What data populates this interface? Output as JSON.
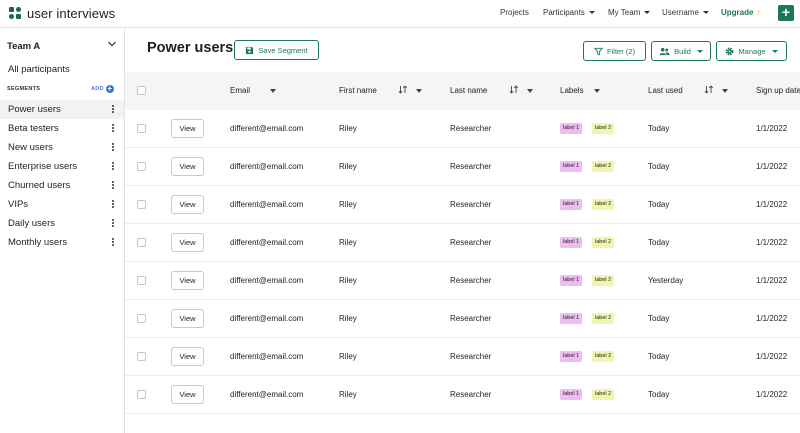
{
  "app": {
    "name": "user interviews",
    "brand_color": "#1c7a53"
  },
  "topnav": {
    "projects": "Projects",
    "participants": "Participants",
    "my_team": "My Team",
    "username": "Username",
    "upgrade": "Upgrade",
    "upgrade_icon": "arrow-up-icon",
    "add_icon": "plus-icon",
    "add_label": "+"
  },
  "sidebar": {
    "team": "Team A",
    "all_participants": "All participants",
    "segments_heading": "SEGMENTS",
    "add_label": "ADD",
    "add_icon": "+",
    "items": [
      {
        "label": "Power users",
        "active": true
      },
      {
        "label": "Beta testers",
        "active": false
      },
      {
        "label": "New users",
        "active": false
      },
      {
        "label": "Enterprise users",
        "active": false
      },
      {
        "label": "Churned users",
        "active": false
      },
      {
        "label": "VIPs",
        "active": false
      },
      {
        "label": "Daily users",
        "active": false
      },
      {
        "label": "Monthly users",
        "active": false
      }
    ]
  },
  "main": {
    "title": "Power users",
    "save_segment": "Save Segment",
    "filter": "Filter (2)",
    "build": "Build",
    "manage": "Manage"
  },
  "table": {
    "columns": {
      "email": "Email",
      "first_name": "First name",
      "last_name": "Last name",
      "labels": "Labels",
      "last_used": "Last used",
      "sign_up": "Sign up date"
    },
    "view_label": "View",
    "label_colors": {
      "label1": "#eebcf0",
      "label2": "#f0f5b0"
    },
    "rows": [
      {
        "email": "different@email.com",
        "first_name": "Riley",
        "last_name": "Researcher",
        "labels": [
          "label 1",
          "label 2"
        ],
        "last_used": "Today",
        "sign_up": "1/1/2022"
      },
      {
        "email": "different@email.com",
        "first_name": "Riley",
        "last_name": "Researcher",
        "labels": [
          "label 1",
          "label 2"
        ],
        "last_used": "Today",
        "sign_up": "1/1/2022"
      },
      {
        "email": "different@email.com",
        "first_name": "Riley",
        "last_name": "Researcher",
        "labels": [
          "label 1",
          "label 2"
        ],
        "last_used": "Today",
        "sign_up": "1/1/2022"
      },
      {
        "email": "different@email.com",
        "first_name": "Riley",
        "last_name": "Researcher",
        "labels": [
          "label 1",
          "label 2"
        ],
        "last_used": "Today",
        "sign_up": "1/1/2022"
      },
      {
        "email": "different@email.com",
        "first_name": "Riley",
        "last_name": "Researcher",
        "labels": [
          "label 1",
          "label 2"
        ],
        "last_used": "Yesterday",
        "sign_up": "1/1/2022"
      },
      {
        "email": "different@email.com",
        "first_name": "Riley",
        "last_name": "Researcher",
        "labels": [
          "label 1",
          "label 2"
        ],
        "last_used": "Today",
        "sign_up": "1/1/2022"
      },
      {
        "email": "different@email.com",
        "first_name": "Riley",
        "last_name": "Researcher",
        "labels": [
          "label 1",
          "label 2"
        ],
        "last_used": "Today",
        "sign_up": "1/1/2022"
      },
      {
        "email": "different@email.com",
        "first_name": "Riley",
        "last_name": "Researcher",
        "labels": [
          "label 1",
          "label 2"
        ],
        "last_used": "Today",
        "sign_up": "1/1/2022"
      }
    ]
  }
}
